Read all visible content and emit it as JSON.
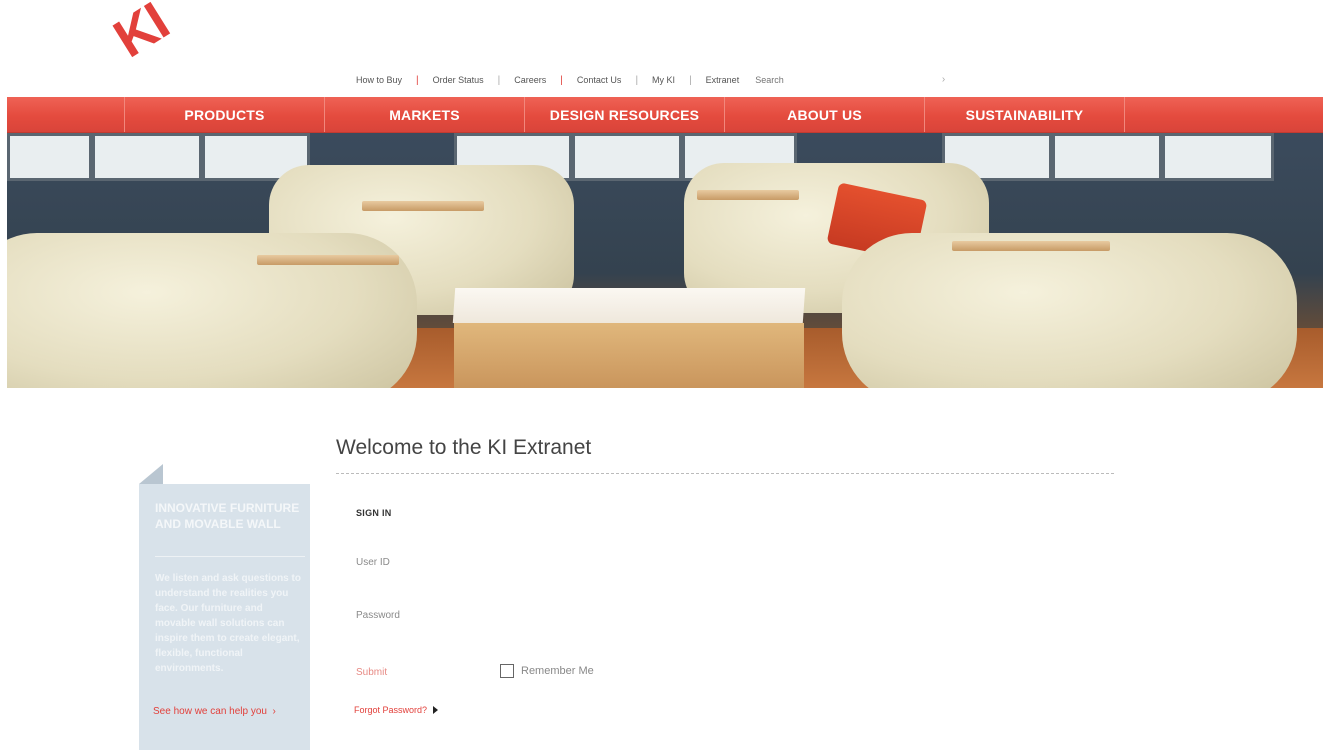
{
  "brand": {
    "logo_text": "KI",
    "accent_color": "#e2403b"
  },
  "utility_nav": {
    "items": [
      "How to Buy",
      "Order Status",
      "Careers",
      "Contact Us",
      "My KI",
      "Extranet"
    ],
    "search_placeholder": "Search",
    "search_go_icon": "chevron-right-icon"
  },
  "main_nav": {
    "items": [
      "PRODUCTS",
      "MARKETS",
      "DESIGN RESOURCES",
      "ABOUT US",
      "SUSTAINABILITY"
    ]
  },
  "hero": {
    "image": "lounge-chairs-photo"
  },
  "promo": {
    "heading": "INNOVATIVE FURNITURE AND MOVABLE WALL",
    "body": "We listen and ask questions to understand the realities you face. Our furniture and movable wall solutions can inspire them to create elegant, flexible, functional environments.",
    "cta": "See how we can help you"
  },
  "login": {
    "title": "Welcome to the KI Extranet",
    "section_heading": "SIGN IN",
    "user_id_label": "User ID",
    "password_label": "Password",
    "submit_label": "Submit",
    "remember_label": "Remember Me",
    "remember_checked": false,
    "forgot_label": "Forgot Password?"
  }
}
